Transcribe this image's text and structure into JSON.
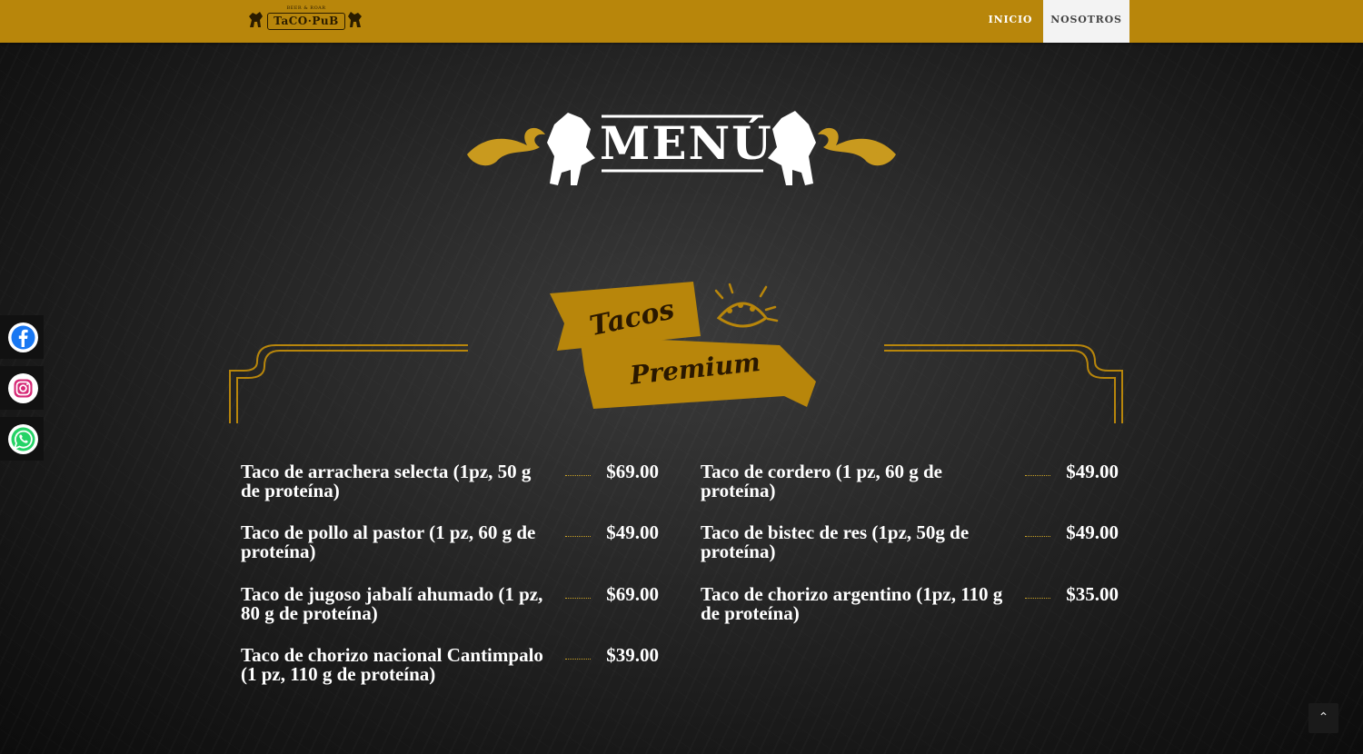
{
  "brand": {
    "logo_main": "TaCO·PuB",
    "logo_sub": "BEER & ROAR",
    "accent_color": "#b8860b"
  },
  "nav": {
    "items": [
      {
        "label": "INICIO"
      },
      {
        "label": "NOSOTROS",
        "active": true
      }
    ]
  },
  "menu_title": "MENÚ",
  "section": {
    "title_line1": "Tacos",
    "title_line2": "Premium"
  },
  "items_left": [
    {
      "name": "Taco de arrachera selecta (1pz, 50 g de proteína)",
      "price": "$69.00"
    },
    {
      "name": "Taco de pollo al pastor (1 pz, 60 g de proteína)",
      "price": "$49.00"
    },
    {
      "name": "Taco de jugoso jabalí ahumado (1 pz, 80 g de proteína)",
      "price": "$69.00"
    },
    {
      "name": "Taco de chorizo nacional Cantimpalo (1 pz, 110 g de proteína)",
      "price": "$39.00"
    }
  ],
  "items_right": [
    {
      "name": "Taco de cordero (1 pz, 60 g de proteína)",
      "price": "$49.00"
    },
    {
      "name": "Taco de bistec de res (1pz, 50g de proteína)",
      "price": "$49.00"
    },
    {
      "name": "Taco de chorizo argentino (1pz, 110 g de proteína)",
      "price": "$35.00"
    }
  ],
  "social": [
    {
      "icon": "facebook-icon",
      "color": "#1877f2"
    },
    {
      "icon": "instagram-icon",
      "color": "#d62976"
    },
    {
      "icon": "whatsapp-icon",
      "color": "#25d366"
    }
  ],
  "scroll_top_icon": "chevron-up-icon"
}
